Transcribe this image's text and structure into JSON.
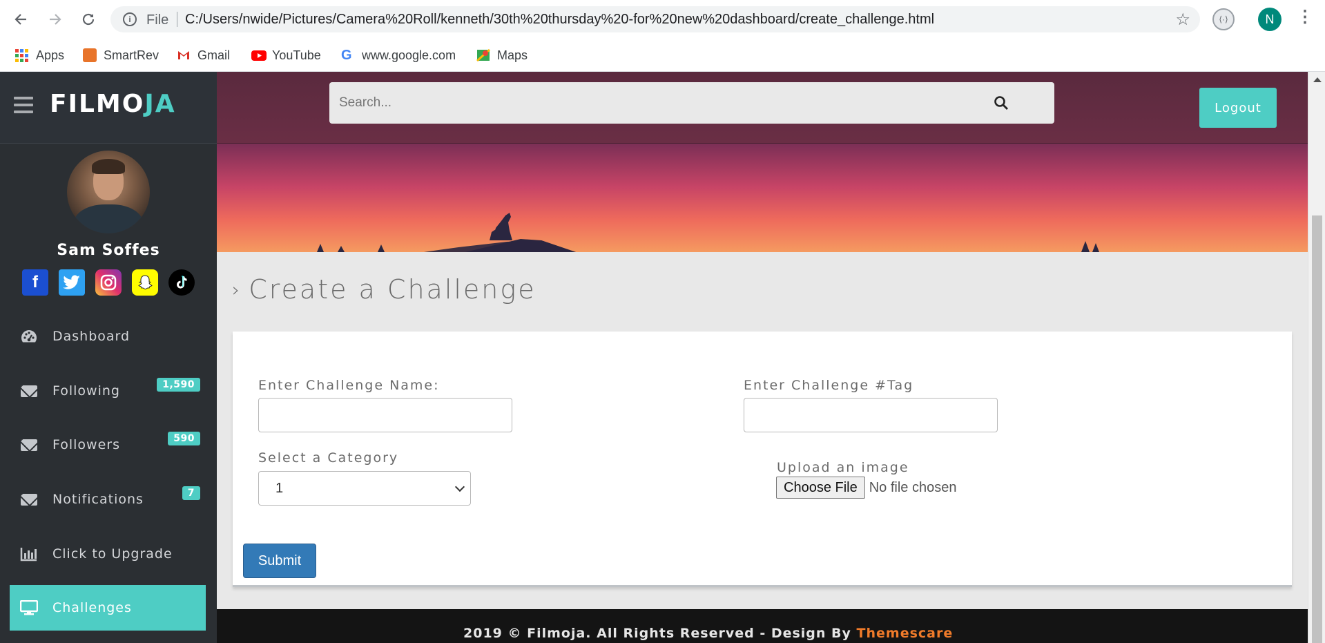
{
  "browser": {
    "file_label": "File",
    "url": "C:/Users/nwide/Pictures/Camera%20Roll/kenneth/30th%20thursday%20-for%20new%20dashboard/create_challenge.html",
    "profile_initial": "N",
    "bookmarks": [
      {
        "label": "Apps",
        "icon": "apps-grid-icon"
      },
      {
        "label": "SmartRev",
        "icon": "smartrev-icon"
      },
      {
        "label": "Gmail",
        "icon": "gmail-icon"
      },
      {
        "label": "YouTube",
        "icon": "youtube-icon"
      },
      {
        "label": "www.google.com",
        "icon": "google-icon"
      },
      {
        "label": "Maps",
        "icon": "maps-icon"
      }
    ]
  },
  "app": {
    "logo_main": "FILMO",
    "logo_accent": "JA",
    "accent_color": "#4ecdc4",
    "user_name": "Sam Soffes",
    "socials": [
      "facebook-icon",
      "twitter-icon",
      "instagram-icon",
      "snapchat-icon",
      "tiktok-icon"
    ],
    "menu": [
      {
        "label": "Dashboard",
        "icon": "dashboard-gauge-icon",
        "badge": ""
      },
      {
        "label": "Following",
        "icon": "envelope-icon",
        "badge": "1,590"
      },
      {
        "label": "Followers",
        "icon": "envelope-icon",
        "badge": "590"
      },
      {
        "label": "Notifications",
        "icon": "envelope-icon",
        "badge": "7"
      },
      {
        "label": "Click to Upgrade",
        "icon": "bar-chart-icon",
        "badge": ""
      },
      {
        "label": "Challenges",
        "icon": "monitor-icon",
        "badge": "",
        "active": true
      }
    ]
  },
  "header": {
    "search_placeholder": "Search...",
    "logout_label": "Logout"
  },
  "page": {
    "title": "Create a Challenge",
    "form": {
      "name_label": "Enter Challenge Name:",
      "name_value": "",
      "tag_label": "Enter Challenge #Tag",
      "tag_value": "",
      "category_label": "Select a Category",
      "category_selected": "1",
      "upload_label": "Upload an image",
      "choose_file_label": "Choose File",
      "file_status": "No file chosen",
      "submit_label": "Submit"
    }
  },
  "footer": {
    "text": "2019 © Filmoja. All Rights Reserved - Design By",
    "link": "Themescare"
  }
}
